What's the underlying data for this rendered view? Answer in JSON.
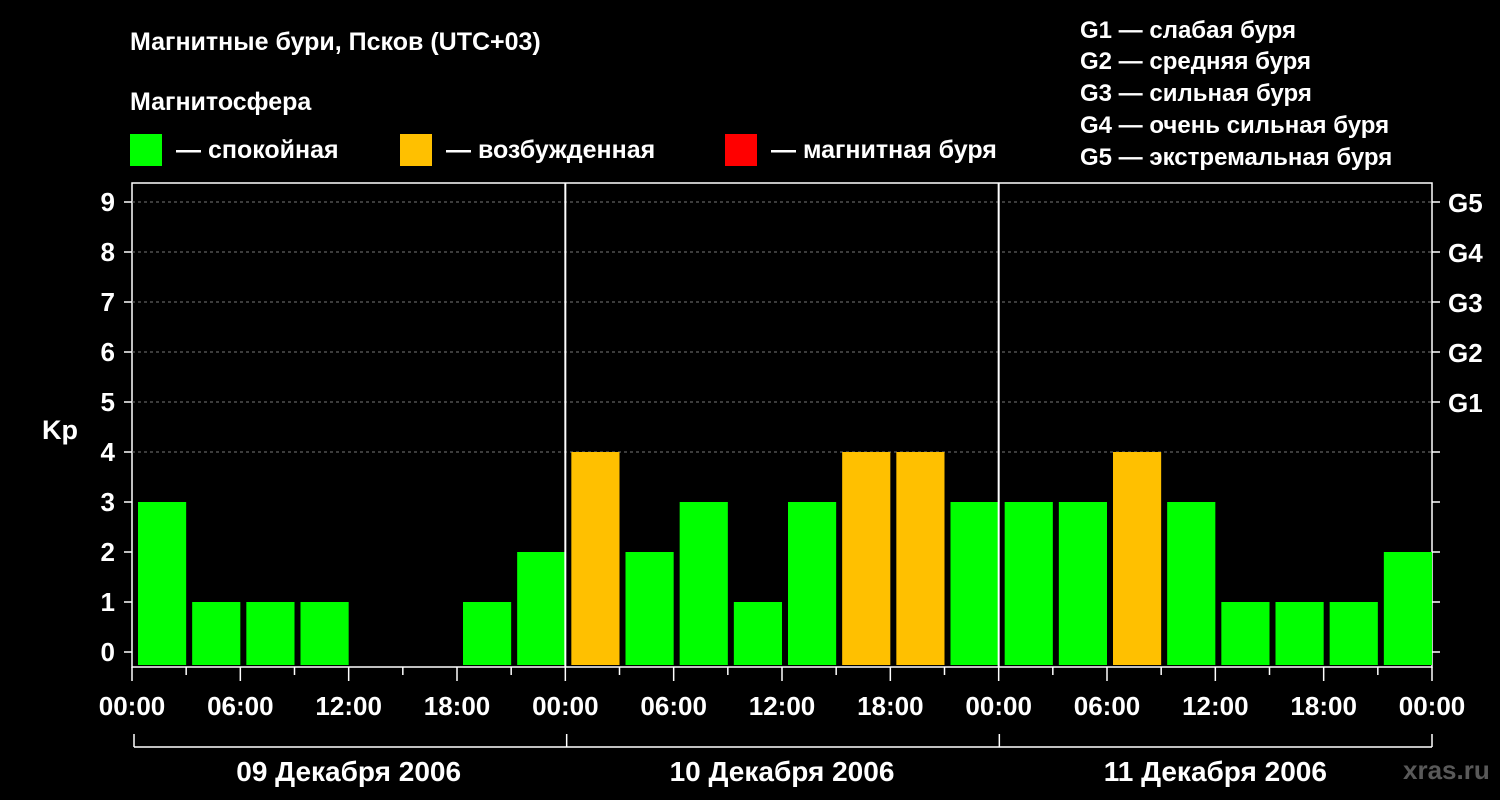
{
  "title": "Магнитные бури, Псков (UTC+03)",
  "subtitle": "Магнитосфера",
  "watermark": "xras.ru",
  "legend": [
    {
      "label": "— спокойная",
      "color": "#00ff00"
    },
    {
      "label": "— возбужденная",
      "color": "#ffc000"
    },
    {
      "label": "— магнитная буря",
      "color": "#ff0000"
    }
  ],
  "storm_scale": [
    "G1 — слабая буря",
    "G2 — средняя буря",
    "G3 — сильная буря",
    "G4 — очень сильная буря",
    "G5 — экстремальная буря"
  ],
  "chart_data": {
    "type": "bar",
    "ylabel": "Kp",
    "ylim": [
      0,
      9
    ],
    "yticks": [
      "0",
      "1",
      "2",
      "3",
      "4",
      "5",
      "6",
      "7",
      "8",
      "9"
    ],
    "right_ticks": [
      {
        "value": 5,
        "label": "G1"
      },
      {
        "value": 6,
        "label": "G2"
      },
      {
        "value": 7,
        "label": "G3"
      },
      {
        "value": 8,
        "label": "G4"
      },
      {
        "value": 9,
        "label": "G5"
      }
    ],
    "xtick_labels": [
      "00:00",
      "06:00",
      "12:00",
      "18:00",
      "00:00",
      "06:00",
      "12:00",
      "18:00",
      "00:00",
      "06:00",
      "12:00",
      "18:00",
      "00:00"
    ],
    "days": [
      "09 Декабря 2006",
      "10 Декабря 2006",
      "11 Декабря 2006"
    ],
    "interval_hours": 3,
    "values": [
      3,
      1,
      1,
      1,
      0,
      0,
      1,
      2,
      4,
      2,
      3,
      1,
      3,
      4,
      4,
      3,
      3,
      3,
      4,
      3,
      1,
      1,
      1,
      2
    ],
    "grid": "dashed horizontal at each Kp level above 3",
    "colors": {
      "calm": "#00ff00",
      "disturbed": "#ffc000",
      "storm": "#ff0000"
    }
  }
}
